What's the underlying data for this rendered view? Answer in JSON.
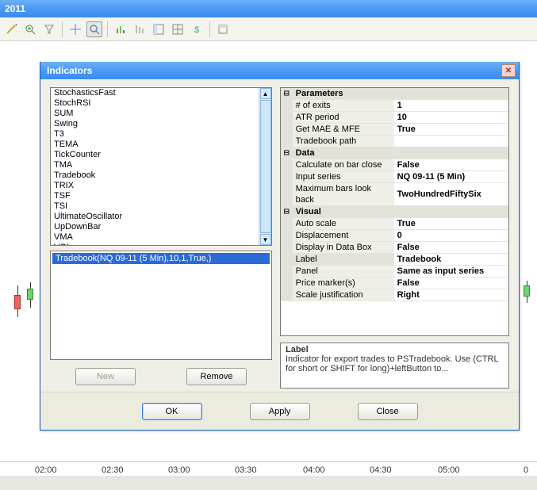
{
  "titlebar": {
    "text": "2011"
  },
  "toolbar": {
    "icons": [
      "pencil",
      "plus-magnifier",
      "funnel",
      "crosshair",
      "magnifier",
      "chart-type",
      "chart-bars",
      "chart-sidebar",
      "chart-grid",
      "dollar",
      "window"
    ]
  },
  "xaxis": [
    "02:00",
    "02:30",
    "03:00",
    "03:30",
    "04:00",
    "04:30",
    "05:00",
    "0"
  ],
  "dialog": {
    "title": "Indicators",
    "list": [
      "StochasticsFast",
      "StochRSI",
      "SUM",
      "Swing",
      "T3",
      "TEMA",
      "TickCounter",
      "TMA",
      "Tradebook",
      "TRIX",
      "TSF",
      "TSI",
      "UltimateOscillator",
      "UpDownBar",
      "VMA",
      "VOL"
    ],
    "selected": "Tradebook(NQ 09-11 (5 Min),10,1,True,)",
    "new_label": "New",
    "remove_label": "Remove",
    "ok_label": "OK",
    "apply_label": "Apply",
    "close_label": "Close"
  },
  "propgrid": {
    "sections": [
      {
        "name": "Parameters",
        "rows": [
          {
            "k": "# of exits",
            "v": "1"
          },
          {
            "k": "ATR period",
            "v": "10"
          },
          {
            "k": "Get MAE & MFE",
            "v": "True"
          },
          {
            "k": "Tradebook path",
            "v": ""
          }
        ]
      },
      {
        "name": "Data",
        "rows": [
          {
            "k": "Calculate on bar close",
            "v": "False"
          },
          {
            "k": "Input series",
            "v": "NQ 09-11 (5 Min)"
          },
          {
            "k": "Maximum bars look back",
            "v": "TwoHundredFiftySix"
          }
        ]
      },
      {
        "name": "Visual",
        "rows": [
          {
            "k": "Auto scale",
            "v": "True"
          },
          {
            "k": "Displacement",
            "v": "0"
          },
          {
            "k": "Display in Data Box",
            "v": "False"
          },
          {
            "k": "Label",
            "v": "Tradebook",
            "hl": true
          },
          {
            "k": "Panel",
            "v": "Same as input series"
          },
          {
            "k": "Price marker(s)",
            "v": "False"
          },
          {
            "k": "Scale justification",
            "v": "Right"
          }
        ]
      }
    ],
    "desc_title": "Label",
    "desc_text": "Indicator for export trades to PSTradebook. Use (CTRL for short or SHIFT for long)+leftButton to..."
  }
}
